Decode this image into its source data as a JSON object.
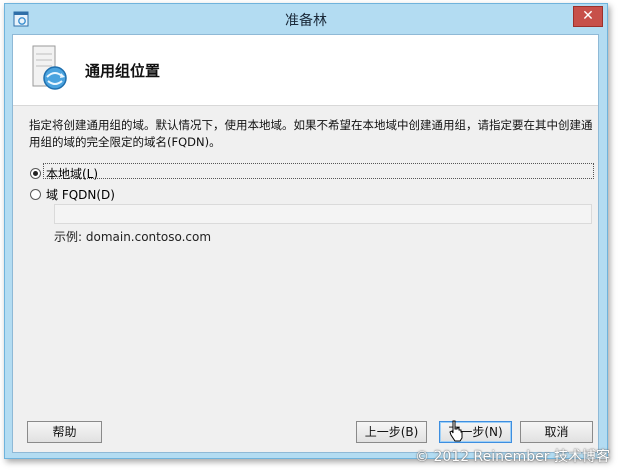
{
  "window": {
    "title": "准备林",
    "close_glyph": "✕"
  },
  "header": {
    "title": "通用组位置",
    "icon": "server-globe-icon"
  },
  "description": "指定将创建通用组的域。默认情况下，使用本地域。如果不希望在本地域中创建通用组，请指定要在其中创建通用组的域的完全限定的域名(FQDN)。",
  "options": [
    {
      "label": "本地域(L)",
      "checked": true
    },
    {
      "label": "域 FQDN(D)",
      "checked": false
    }
  ],
  "fqdn_input": {
    "value": ""
  },
  "example": "示例: domain.contoso.com",
  "buttons": {
    "help": "帮助",
    "back": "上一步(B)",
    "next": "下一步(N)",
    "cancel": "取消"
  },
  "watermark": "© 2012 Reinember 技术博客"
}
